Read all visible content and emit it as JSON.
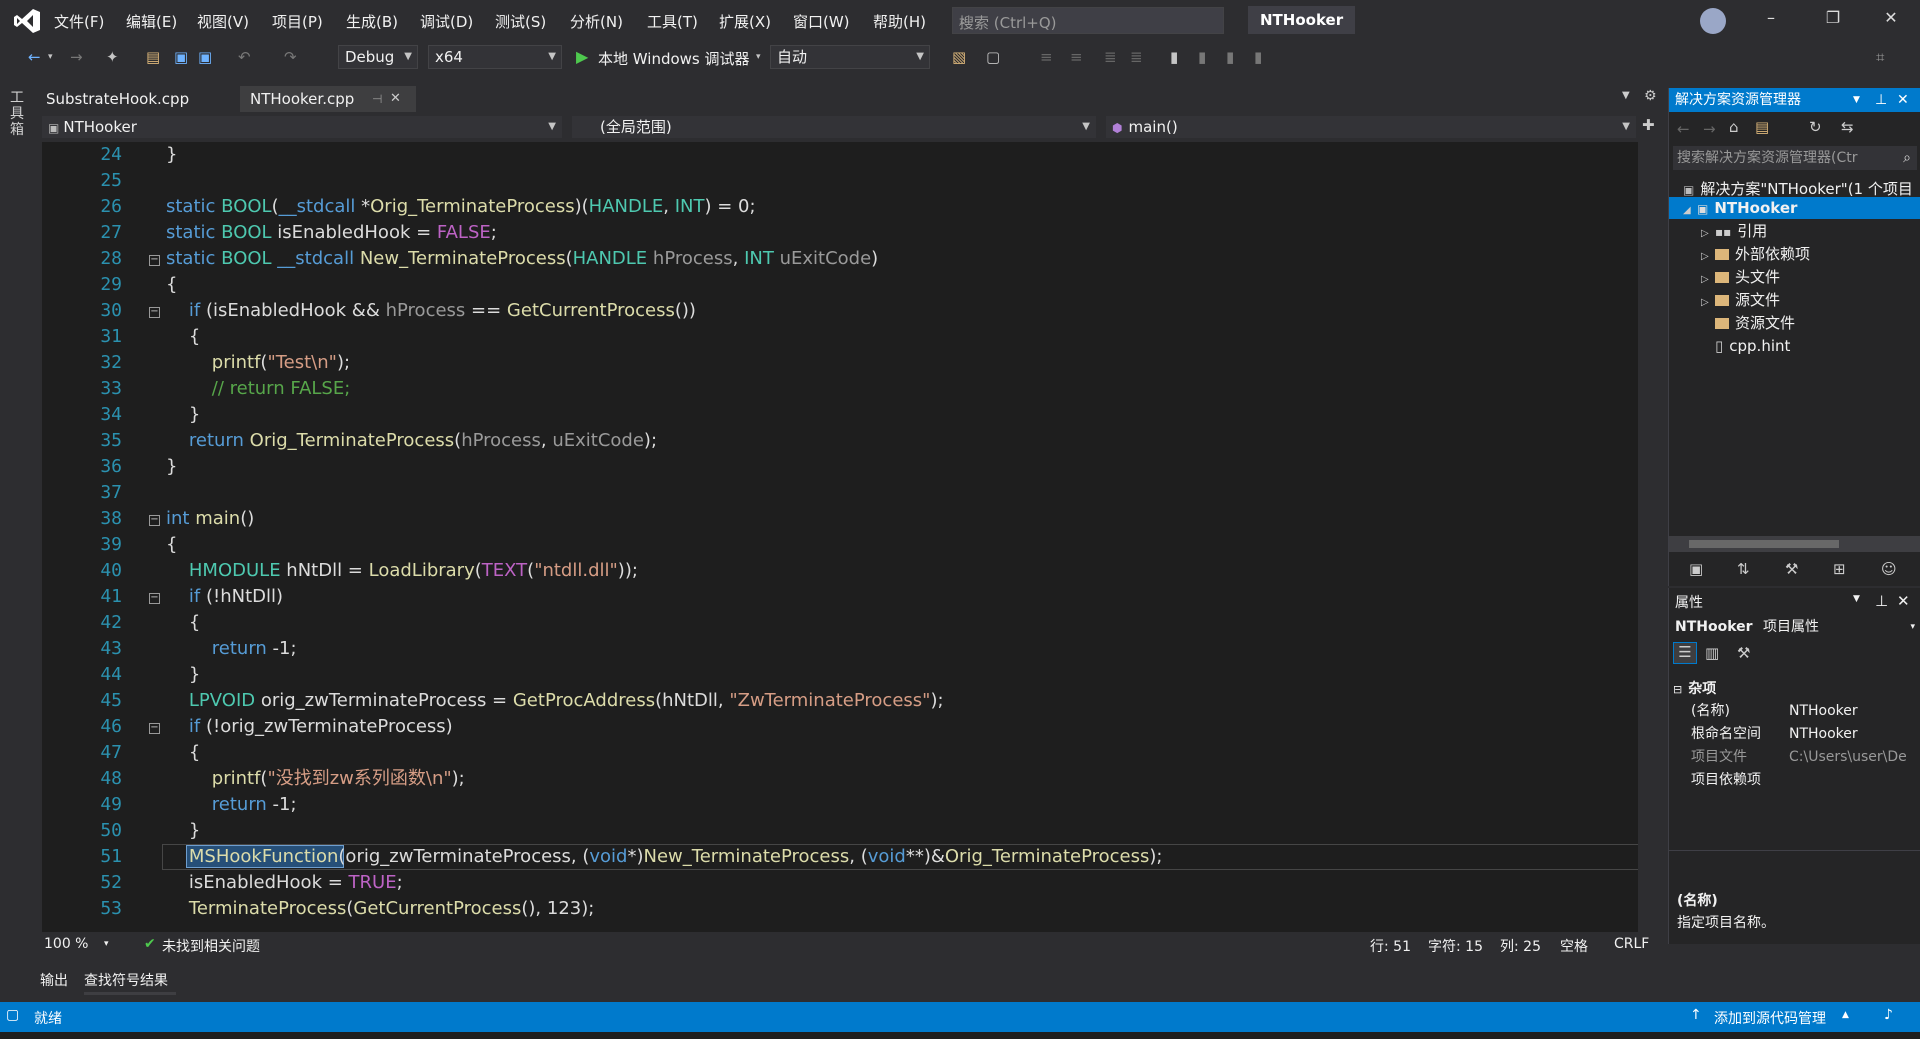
{
  "menu": {
    "items": [
      "文件(F)",
      "编辑(E)",
      "视图(V)",
      "项目(P)",
      "生成(B)",
      "调试(D)",
      "测试(S)",
      "分析(N)",
      "工具(T)",
      "扩展(X)",
      "窗口(W)",
      "帮助(H)"
    ],
    "search_placeholder": "搜索 (Ctrl+Q)",
    "app_title": "NTHooker"
  },
  "toolbar": {
    "config": "Debug",
    "platform": "x64",
    "run_label": "本地 Windows 调试器",
    "auto": "自动"
  },
  "toolbox_label": "工具箱",
  "tabs": [
    {
      "label": "SubstrateHook.cpp"
    },
    {
      "label": "NTHooker.cpp",
      "pin": "⊣",
      "close": "✕"
    }
  ],
  "navbar": {
    "project": "NTHooker",
    "scope": "(全局范围)",
    "member": "main()"
  },
  "editor": {
    "line_numbers": [
      "24",
      "25",
      "26",
      "27",
      "28",
      "29",
      "30",
      "31",
      "32",
      "33",
      "34",
      "35",
      "36",
      "37",
      "38",
      "39",
      "40",
      "41",
      "42",
      "43",
      "44",
      "45",
      "46",
      "47",
      "48",
      "49",
      "50",
      "51",
      "52",
      "53"
    ],
    "lines": [
      "}",
      "",
      "static BOOL(__stdcall *Orig_TerminateProcess)(HANDLE, INT) = 0;",
      "static BOOL isEnabledHook = FALSE;",
      "static BOOL __stdcall New_TerminateProcess(HANDLE hProcess, INT uExitCode)",
      "{",
      "    if (isEnabledHook && hProcess == GetCurrentProcess())",
      "    {",
      "        printf(\"Test\\n\");",
      "        // return FALSE;",
      "    }",
      "    return Orig_TerminateProcess(hProcess, uExitCode);",
      "}",
      "",
      "int main()",
      "{",
      "    HMODULE hNtDll = LoadLibrary(TEXT(\"ntdll.dll\"));",
      "    if (!hNtDll)",
      "    {",
      "        return -1;",
      "    }",
      "    LPVOID orig_zwTerminateProcess = GetProcAddress(hNtDll, \"ZwTerminateProcess\");",
      "    if (!orig_zwTerminateProcess)",
      "    {",
      "        printf(\"没找到zw系列函数\\n\");",
      "        return -1;",
      "    }",
      "    MSHookFunction(orig_zwTerminateProcess, (void*)New_TerminateProcess, (void**)&Orig_TerminateProcess);",
      "    isEnabledHook = TRUE;",
      "    TerminateProcess(GetCurrentProcess(), 123);"
    ]
  },
  "editor_status": {
    "zoom": "100 %",
    "issues": "未找到相关问题",
    "line": "行: 51",
    "char": "字符: 15",
    "col": "列: 25",
    "space": "空格",
    "eol": "CRLF"
  },
  "output_tabs": [
    "输出",
    "查找符号结果"
  ],
  "statusbar": {
    "ready": "就绪",
    "source_control": "添加到源代码管理"
  },
  "solution_explorer": {
    "title": "解决方案资源管理器",
    "search_placeholder": "搜索解决方案资源管理器(Ctr",
    "solution": "解决方案\"NTHooker\"(1 个项目",
    "project": "NTHooker",
    "items": [
      "引用",
      "外部依赖项",
      "头文件",
      "源文件",
      "资源文件",
      "cpp.hint"
    ]
  },
  "properties": {
    "title": "属性",
    "object": "NTHooker",
    "object_type": "项目属性",
    "category": "杂项",
    "rows": [
      {
        "key": "(名称)",
        "value": "NTHooker"
      },
      {
        "key": "根命名空间",
        "value": "NTHooker"
      },
      {
        "key": "项目文件",
        "value": "C:\\Users\\user\\De"
      },
      {
        "key": "项目依赖项",
        "value": ""
      }
    ],
    "desc_title": "(名称)",
    "desc_text": "指定项目名称。"
  }
}
